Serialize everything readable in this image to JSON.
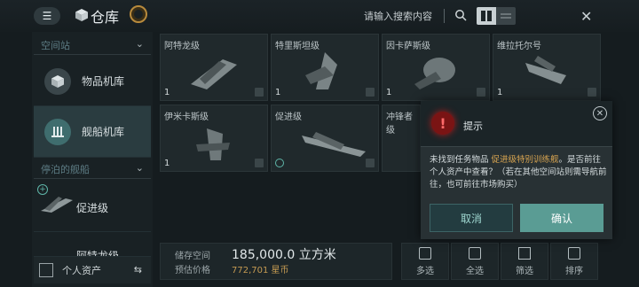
{
  "header": {
    "title": "仓库",
    "search_placeholder": "请输入搜索内容"
  },
  "sidebar": {
    "section1": "空间站",
    "items": [
      {
        "label": "物品机库"
      },
      {
        "label": "舰船机库"
      }
    ],
    "section2": "停泊的舰船",
    "ships": [
      {
        "label": "促进级"
      },
      {
        "label": "阿特龙级"
      }
    ],
    "personal_assets": "个人资产"
  },
  "grid": [
    {
      "name": "阿特龙级",
      "qty": "1"
    },
    {
      "name": "特里斯坦级",
      "qty": "1"
    },
    {
      "name": "因卡萨斯级",
      "qty": "1"
    },
    {
      "name": "维拉托尔号",
      "qty": "1"
    },
    {
      "name": "伊米卡斯级",
      "qty": "1"
    },
    {
      "name": "促进级",
      "qty": ""
    },
    {
      "name": "冲锋者级",
      "qty": ""
    }
  ],
  "stats": {
    "storage_label": "储存空间",
    "storage_value": "185,000.0 立方米",
    "price_label": "预估价格",
    "price_value": "772,701 星币"
  },
  "toolbar": {
    "multi": "多选",
    "all": "全选",
    "filter": "筛选",
    "sort": "排序"
  },
  "dialog": {
    "title": "提示",
    "msg_before": "未找到任务物品 ",
    "msg_highlight": "促进级特别训练舰",
    "msg_after": "。是否前往个人资产中查看？（若在其他空间站则需导航前往，也可前往市场购买）",
    "cancel": "取消",
    "confirm": "确认"
  },
  "colors": {
    "accent": "#5a9c94",
    "highlight": "#d6a350",
    "alert": "#b01d1d"
  }
}
